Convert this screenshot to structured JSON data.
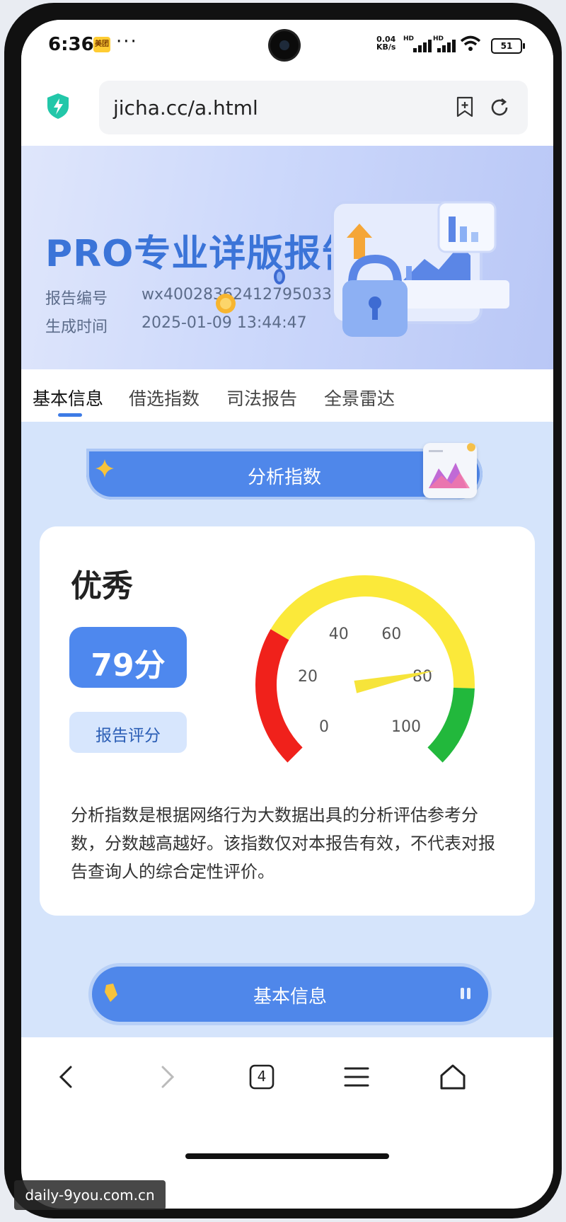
{
  "status_bar": {
    "time": "6:36",
    "app_badge": "美团",
    "more": "···",
    "net_speed": "0.04",
    "net_unit": "KB/s",
    "hd1": "HD",
    "hd2": "HD",
    "battery": "51"
  },
  "browser": {
    "url": "jicha.cc/a.html",
    "icons": [
      "shield-icon",
      "bookmark-add-icon",
      "reload-icon"
    ]
  },
  "hero": {
    "title": "PRO专业详版报告",
    "report_no_label": "报告编号",
    "report_no_value": "wx400283624127950330",
    "time_label": "生成时间",
    "time_value": "2025-01-09 13:44:47"
  },
  "tabs": [
    {
      "label": "基本信息",
      "active": true
    },
    {
      "label": "借选指数",
      "active": false
    },
    {
      "label": "司法报告",
      "active": false
    },
    {
      "label": "全景雷达",
      "active": false
    }
  ],
  "section_header": {
    "label": "分析指数"
  },
  "score_card": {
    "grade": "优秀",
    "score_text": "79分",
    "score_label": "报告评分",
    "gauge": {
      "value": 79,
      "min": 0,
      "max": 100,
      "ticks": [
        "0",
        "20",
        "40",
        "60",
        "80",
        "100"
      ],
      "colors": {
        "low": "#f0211b",
        "mid": "#fbe93a",
        "high": "#22b83c",
        "needle": "#f6e43a"
      }
    },
    "description": "分析指数是根据网络行为大数据出具的分析评估参考分数，分数越高越好。该指数仅对本报告有效，不代表对报告查询人的综合定性评价。"
  },
  "next_section": {
    "label": "基本信息"
  },
  "navbar": {
    "icons": [
      "back-icon",
      "forward-icon",
      "tabs-icon",
      "menu-icon",
      "home-icon"
    ],
    "tab_count": "4"
  },
  "watermark": "daily-9you.com.cn",
  "colors": {
    "accent": "#4f87ea",
    "hero_title": "#3b74d8",
    "content_bg": "#d5e4fb"
  }
}
